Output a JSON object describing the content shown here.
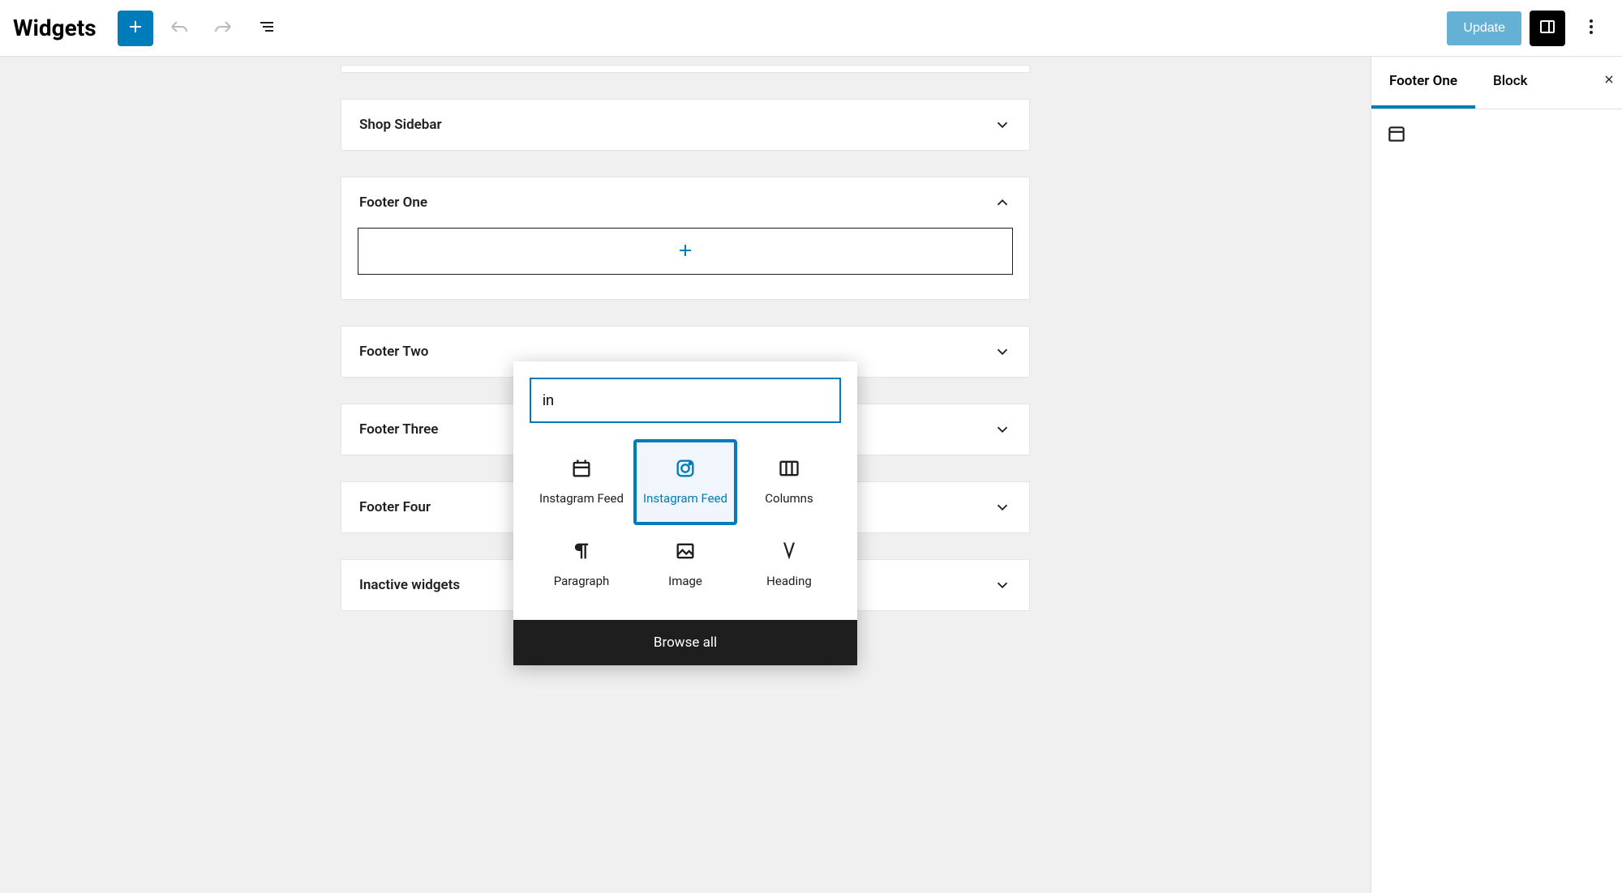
{
  "header": {
    "title": "Widgets",
    "update_label": "Update"
  },
  "areas": {
    "shop_sidebar": "Shop Sidebar",
    "footer_one": "Footer One",
    "footer_two": "Footer Two",
    "footer_three": "Footer Three",
    "footer_four": "Footer Four",
    "inactive": "Inactive widgets"
  },
  "inserter": {
    "search_value": "in",
    "blocks": {
      "instagram_feed_1": "Instagram Feed",
      "instagram_feed_2": "Instagram Feed",
      "columns": "Columns",
      "paragraph": "Paragraph",
      "image": "Image",
      "heading": "Heading"
    },
    "browse_all": "Browse all"
  },
  "sidebar": {
    "tabs": {
      "area": "Footer One",
      "block": "Block"
    }
  }
}
